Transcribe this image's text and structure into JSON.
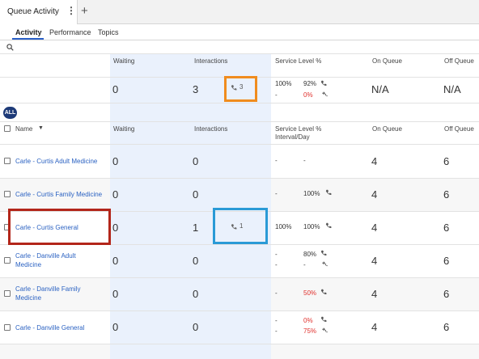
{
  "tab": {
    "title": "Queue Activity",
    "menu": "⋮",
    "add": "+"
  },
  "subtabs": [
    "Activity",
    "Performance",
    "Topics"
  ],
  "columns": {
    "waiting": "Waiting",
    "interactions": "Interactions",
    "service_level": "Service Level %",
    "service_level_sub": "Interval/Day",
    "on_queue": "On Queue",
    "off_queue": "Off Queue",
    "name": "Name"
  },
  "summary": {
    "waiting": "0",
    "interactions": "3",
    "interactions_badge": "3",
    "sl_interval": "100%",
    "sl_dash": "-",
    "sl_day": "92%",
    "sl_day2": "0%",
    "on_queue": "N/A",
    "off_queue": "N/A"
  },
  "all_badge": "ALL",
  "rows": [
    {
      "name": "Carle - Curtis Adult Medicine",
      "waiting": "0",
      "interactions": "0",
      "sl_a": "-",
      "sl_b": "-",
      "on_queue": "4",
      "off_queue": "6"
    },
    {
      "name": "Carle - Curtis Family Medicine",
      "waiting": "0",
      "interactions": "0",
      "sl_a": "-",
      "sl_b": "100%",
      "on_queue": "4",
      "off_queue": "6"
    },
    {
      "name": "Carle - Curtis General",
      "waiting": "0",
      "interactions": "1",
      "interactions_badge": "1",
      "sl_a": "100%",
      "sl_b": "100%",
      "on_queue": "4",
      "off_queue": "6"
    },
    {
      "name": "Carle - Danville Adult Medicine",
      "name_line1": "Carle - Danville Adult",
      "name_line2": "Medicine",
      "waiting": "0",
      "interactions": "0",
      "sl_a": "-",
      "sl_a2": "-",
      "sl_b": "80%",
      "sl_b2": "-",
      "on_queue": "4",
      "off_queue": "6"
    },
    {
      "name": "Carle - Danville Family Medicine",
      "name_line1": "Carle - Danville Family",
      "name_line2": "Medicine",
      "waiting": "0",
      "interactions": "0",
      "sl_a": "-",
      "sl_b": "50%",
      "on_queue": "4",
      "off_queue": "6"
    },
    {
      "name": "Carle - Danville General",
      "waiting": "0",
      "interactions": "0",
      "sl_a": "-",
      "sl_a2": "-",
      "sl_b": "0%",
      "sl_b2": "75%",
      "on_queue": "4",
      "off_queue": "6"
    }
  ],
  "colors": {
    "accent": "#2a60c8",
    "link": "#2b62c2",
    "danger": "#e0302c",
    "column_highlight": "#eaf1fc",
    "badge": "#1d3a78"
  }
}
